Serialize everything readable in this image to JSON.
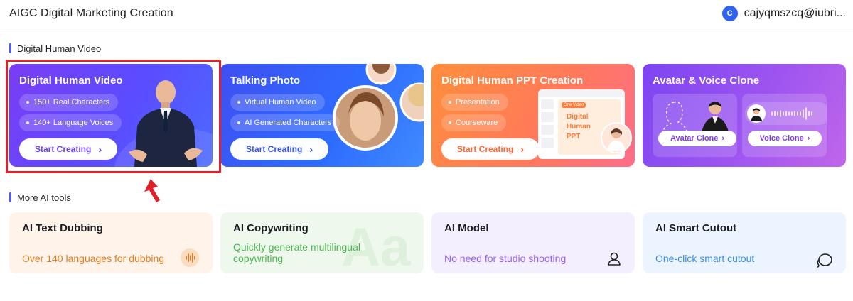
{
  "header": {
    "title": "AIGC Digital Marketing Creation",
    "user_initial": "C",
    "user_email": "cajyqmszcq@iubri..."
  },
  "sections": {
    "digital_human": "Digital Human Video",
    "more_tools": "More AI tools"
  },
  "cards": [
    {
      "title": "Digital Human Video",
      "features": [
        "150+ Real Characters",
        "140+ Language Voices"
      ],
      "button": "Start Creating"
    },
    {
      "title": "Talking Photo",
      "features": [
        "Virtual Human Video",
        "AI Generated Characters"
      ],
      "button": "Start Creating"
    },
    {
      "title": "Digital Human PPT Creation",
      "features": [
        "Presentation",
        "Courseware"
      ],
      "button": "Start Creating",
      "slide_tag": "One Video",
      "slide_text": "Digital Human PPT"
    },
    {
      "title": "Avatar & Voice Clone",
      "avatar_button": "Avatar Clone",
      "voice_button": "Voice Clone"
    }
  ],
  "tools": [
    {
      "title": "AI Text Dubbing",
      "desc": "Over 140 languages for dubbing",
      "icon": "sound-wave-icon"
    },
    {
      "title": "AI Copywriting",
      "desc": "Quickly generate multilingual copywriting",
      "watermark": "Aa"
    },
    {
      "title": "AI Model",
      "desc": "No need for studio shooting",
      "icon": "person-icon"
    },
    {
      "title": "AI Smart Cutout",
      "desc": "One-click smart cutout",
      "icon": "lasso-icon"
    }
  ],
  "colors": {
    "accent": "#4f58ff",
    "highlight": "#e0212a"
  }
}
